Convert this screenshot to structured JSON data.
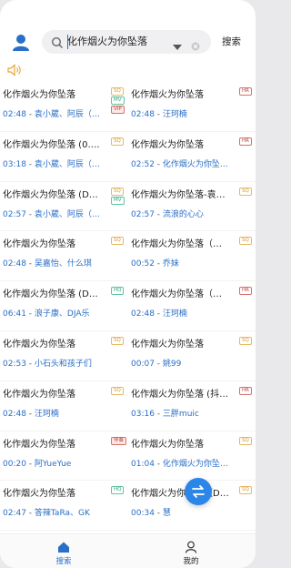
{
  "header": {
    "search": {
      "query": "化作烟火为你坠落",
      "button": "搜索"
    },
    "volume_hint": "·"
  },
  "results": [
    {
      "title": "化作烟火为你坠落",
      "time": "02:48",
      "artist": "袁小葳、阿辰（…",
      "badges": [
        "SQ",
        "MV",
        "VIP"
      ]
    },
    {
      "title": "化作烟火为你坠落",
      "time": "02:48",
      "artist": "汪珂楠",
      "badges": [
        "HR"
      ]
    },
    {
      "title": "化作烟火为你坠落 (0.…",
      "time": "03:18",
      "artist": "袁小葳、阿辰（…",
      "badges": [
        "SQ"
      ]
    },
    {
      "title": "化作烟火为你坠落",
      "time": "02:52",
      "artist": "化作烟火为你坠…",
      "badges": [
        "HR"
      ]
    },
    {
      "title": "化作烟火为你坠落 (D…",
      "time": "02:57",
      "artist": "袁小葳、阿辰（…",
      "badges": [
        "SQ",
        "MV"
      ]
    },
    {
      "title": "化作烟火为你坠落-袁…",
      "time": "02:57",
      "artist": "流浪的心心",
      "badges": [
        "SQ"
      ]
    },
    {
      "title": "化作烟火为你坠落",
      "time": "02:48",
      "artist": "吴嘉怡、什么琪",
      "badges": [
        "SQ"
      ]
    },
    {
      "title": "化作烟火为你坠落（…",
      "time": "00:52",
      "artist": "乔妹",
      "badges": [
        "SQ"
      ]
    },
    {
      "title": "化作烟火为你坠落 (D…",
      "time": "06:41",
      "artist": "浪子康、DJA乐",
      "badges": [
        "HQ"
      ]
    },
    {
      "title": "化作烟火为你坠落（…",
      "time": "02:48",
      "artist": "汪珂楠",
      "badges": [
        "HR"
      ]
    },
    {
      "title": "化作烟火为你坠落",
      "time": "02:53",
      "artist": "小石头和孩子们",
      "badges": [
        "SQ"
      ]
    },
    {
      "title": "化作烟火为你坠落",
      "time": "00:07",
      "artist": "姚99",
      "badges": [
        "SQ"
      ]
    },
    {
      "title": "化作烟火为你坠落",
      "time": "02:48",
      "artist": "汪珂楠",
      "badges": [
        "SQ"
      ]
    },
    {
      "title": "化作烟火为你坠落 (抖…",
      "time": "03:16",
      "artist": "三胖muic",
      "badges": [
        "HR"
      ]
    },
    {
      "title": "化作烟火为你坠落",
      "time": "00:20",
      "artist": "阿YueYue",
      "badges": [
        "伴奏"
      ]
    },
    {
      "title": "化作烟火为你坠落",
      "time": "01:04",
      "artist": "化作烟火为你坠…",
      "badges": [
        "SQ"
      ]
    },
    {
      "title": "化作烟火为你坠落",
      "time": "02:47",
      "artist": "答辣TaRa、GK",
      "badges": [
        "HQ"
      ]
    },
    {
      "title": "化作烟火为你坠落（D…",
      "time": "00:34",
      "artist": "慧",
      "badges": [
        "SQ"
      ]
    }
  ],
  "tabs": [
    {
      "label": "搜索",
      "active": true
    },
    {
      "label": "我的",
      "active": false
    }
  ],
  "colors": {
    "accent": "#2a6fc7",
    "sq": "#d29a2c",
    "hr": "#c0443e",
    "hq": "#2fa57d",
    "fab": "#2b86e8"
  }
}
